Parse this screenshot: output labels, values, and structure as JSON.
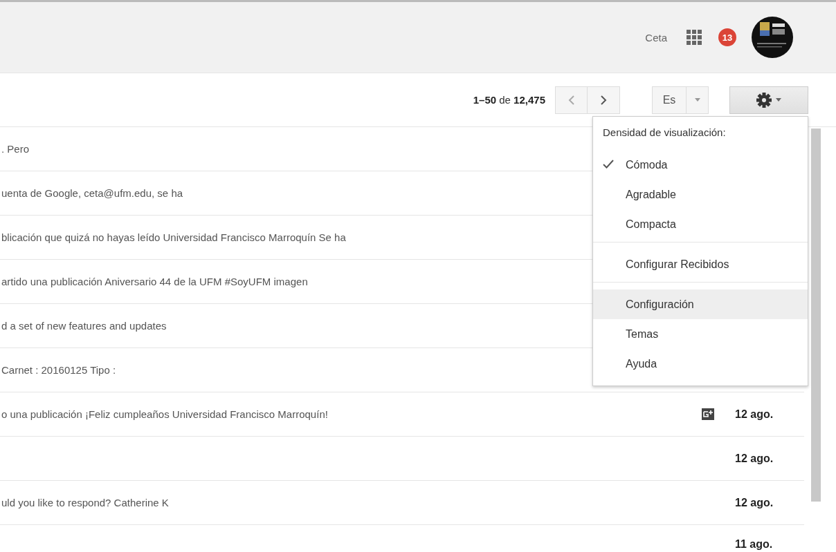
{
  "header": {
    "account": "Ceta",
    "notifications": "13"
  },
  "toolbar": {
    "range": "**1–50** de **12,475**",
    "language": "Es"
  },
  "messages": [
    {
      "snippet": ". Pero"
    },
    {
      "snippet": "uenta de Google, ceta@ufm.edu, se ha"
    },
    {
      "snippet": "blicación que quizá no hayas leído Universidad Francisco Marroquín Se ha"
    },
    {
      "snippet": "artido una publicación Aniversario 44 de la UFM #SoyUFM imagen"
    },
    {
      "snippet": "d a set of new features and updates"
    },
    {
      "snippet": "Carnet : 20160125 Tipo :"
    },
    {
      "snippet": "o una publicación ¡Feliz cumpleaños Universidad Francisco Marroquín!",
      "gplus": true,
      "date": "12 ago."
    },
    {
      "date": "12 ago."
    },
    {
      "snippet": "uld you like to respond? Catherine K",
      "date": "12 ago."
    },
    {
      "date": "11 ago."
    }
  ],
  "settings_menu": {
    "title": "Densidad de visualización:",
    "sections": [
      {
        "items": [
          {
            "label": "Cómoda",
            "checked": true,
            "hovered": false
          },
          {
            "label": "Agradable",
            "checked": false,
            "hovered": false
          },
          {
            "label": "Compacta",
            "checked": false,
            "hovered": false
          }
        ]
      },
      {
        "items": [
          {
            "label": "Configurar Recibidos",
            "checked": false,
            "hovered": false
          }
        ]
      },
      {
        "items": [
          {
            "label": "Configuración",
            "checked": false,
            "hovered": true
          },
          {
            "label": "Temas",
            "checked": false,
            "hovered": false
          },
          {
            "label": "Ayuda",
            "checked": false,
            "hovered": false
          }
        ]
      }
    ]
  }
}
